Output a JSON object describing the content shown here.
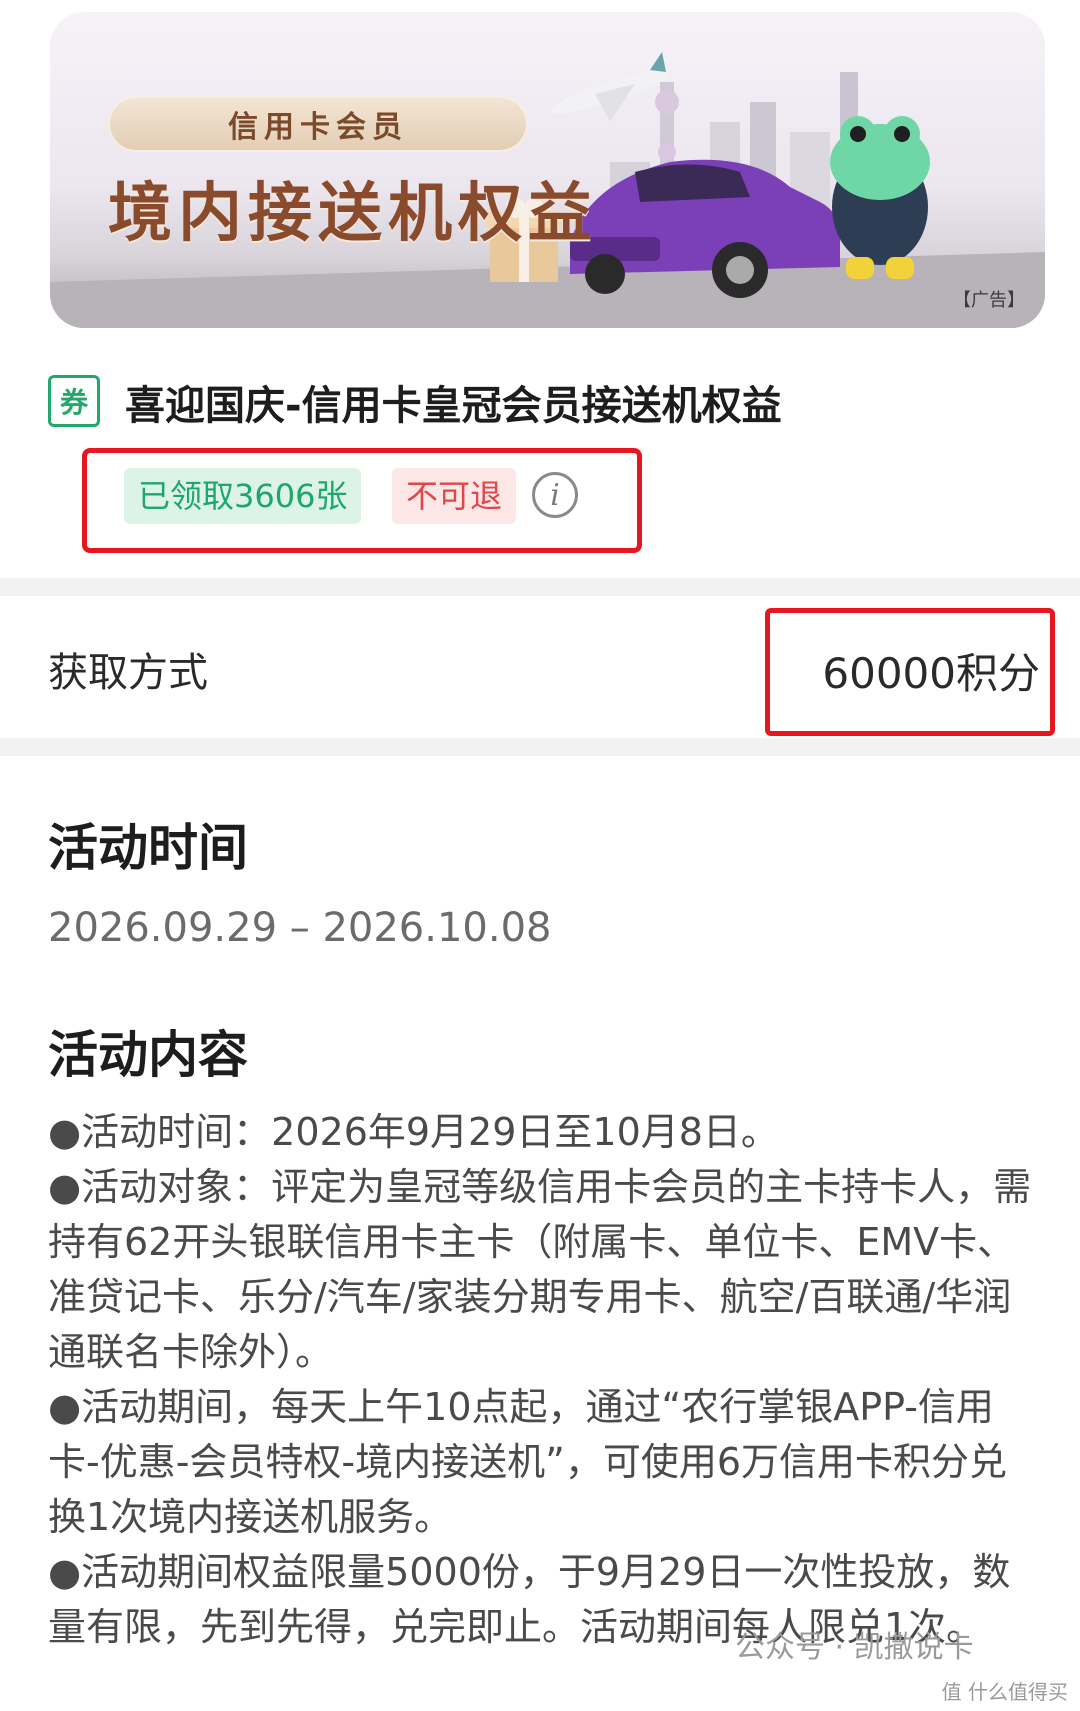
{
  "banner": {
    "pill_text": "信用卡会员",
    "headline": "境内接送机权益",
    "ad_tag": "【广告】"
  },
  "offer": {
    "coupon_icon": "券",
    "title": "喜迎国庆-信用卡皇冠会员接送机权益",
    "claimed": "已领取3606张",
    "non_refundable": "不可退",
    "info_glyph": "i"
  },
  "acquisition": {
    "label": "获取方式",
    "value": "60000积分"
  },
  "activity_time": {
    "title": "活动时间",
    "range": "2026.09.29 – 2026.10.08"
  },
  "activity_content": {
    "title": "活动内容",
    "paragraphs": [
      "●活动时间：2026年9月29日至10月8日。",
      "●活动对象：评定为皇冠等级信用卡会员的主卡持卡人，需持有62开头银联信用卡主卡（附属卡、单位卡、EMV卡、准贷记卡、乐分/汽车/家装分期专用卡、航空/百联通/华润通联名卡除外）。",
      "●活动期间，每天上午10点起，通过“农行掌银APP-信用卡-优惠-会员特权-境内接送机”，可使用6万信用卡积分兑换1次境内接送机服务。",
      "●活动期间权益限量5000份，于9月29日一次性投放，数量有限，先到先得，兑完即止。活动期间每人限兑1次。"
    ]
  },
  "watermark": {
    "text": "公众号 · 凯撒说卡",
    "corner": "值 什么值得买"
  },
  "colors": {
    "green": "#23a86c",
    "red_highlight": "#e6171e",
    "tag_red_text": "#e0474a"
  }
}
